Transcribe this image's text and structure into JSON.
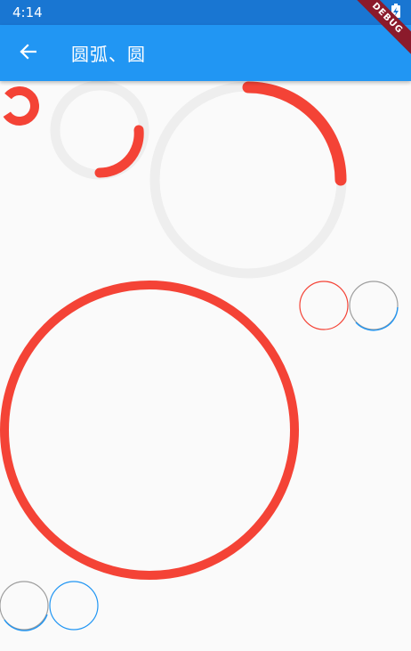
{
  "status_bar": {
    "time": "4:14",
    "wifi_icon": "wifi-off-icon",
    "battery_icon": "battery-charging-icon"
  },
  "app_bar": {
    "title": "圆弧、圆",
    "back_icon": "arrow-back-icon"
  },
  "debug_banner": {
    "label": "DEBUG"
  },
  "colors": {
    "status_bar": "#1976d2",
    "app_bar": "#2196f3",
    "arc": "#f44336",
    "track": "#eeeeee",
    "thin_grey": "#9e9e9e",
    "thin_blue": "#2196f3",
    "background": "#fafafa"
  }
}
